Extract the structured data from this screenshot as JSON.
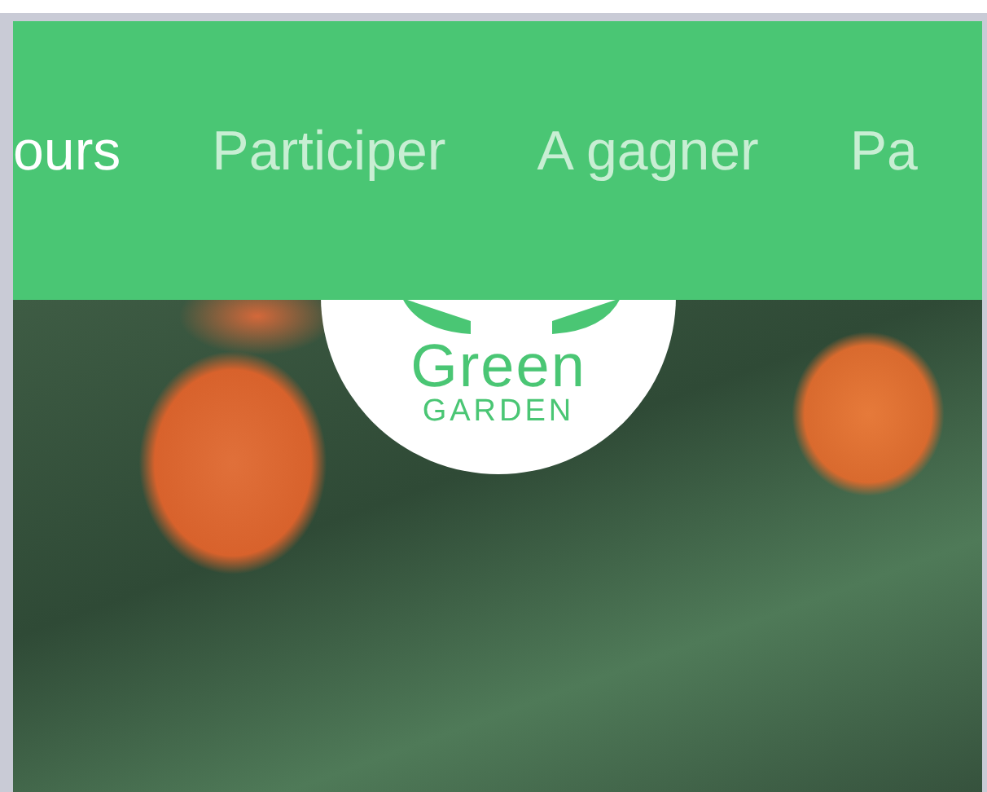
{
  "nav": {
    "items": [
      {
        "label": "ours",
        "selected": true
      },
      {
        "label": "Participer",
        "selected": false
      },
      {
        "label": "A gagner",
        "selected": false
      },
      {
        "label": "Pa",
        "selected": false
      }
    ]
  },
  "logo": {
    "title": "Green",
    "subtitle": "GARDEN"
  }
}
